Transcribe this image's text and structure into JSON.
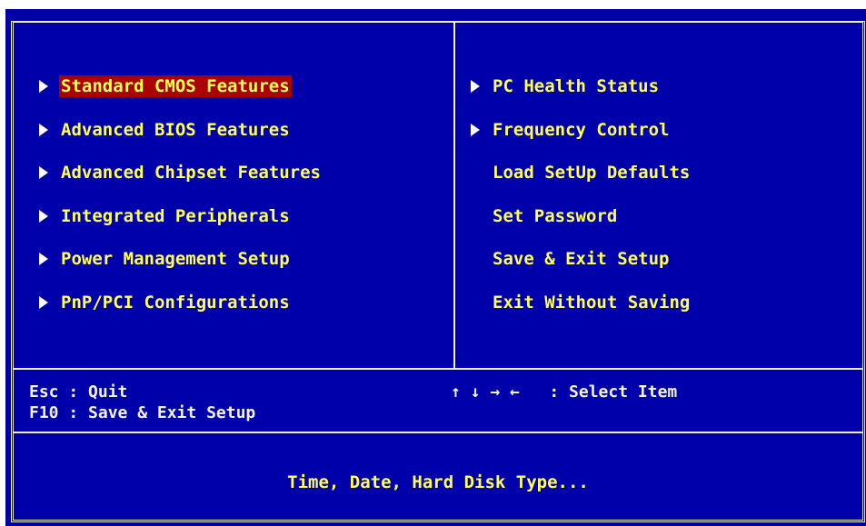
{
  "left_menu": [
    {
      "label": "Standard CMOS Features",
      "arrow": true
    },
    {
      "label": "Advanced BIOS Features",
      "arrow": true
    },
    {
      "label": "Advanced Chipset Features",
      "arrow": true
    },
    {
      "label": "Integrated Peripherals",
      "arrow": true
    },
    {
      "label": "Power Management Setup",
      "arrow": true
    },
    {
      "label": "PnP/PCI Configurations",
      "arrow": true
    }
  ],
  "right_menu": [
    {
      "label": "PC Health Status",
      "arrow": true
    },
    {
      "label": "Frequency Control",
      "arrow": true
    },
    {
      "label": "Load SetUp Defaults",
      "arrow": false
    },
    {
      "label": "Set Password",
      "arrow": false
    },
    {
      "label": "Save & Exit Setup",
      "arrow": false
    },
    {
      "label": "Exit Without Saving",
      "arrow": false
    }
  ],
  "help": {
    "esc": "Esc : Quit",
    "f10": "F10 : Save & Exit Setup",
    "arrows": "↑ ↓ → ←   : Select Item"
  },
  "description": "Time, Date, Hard Disk Type...",
  "colors": {
    "background": "#0000aa",
    "text": "#ffff55",
    "highlight": "#aa0000",
    "border": "#f2f2f2"
  },
  "selected_item": "Standard CMOS Features"
}
